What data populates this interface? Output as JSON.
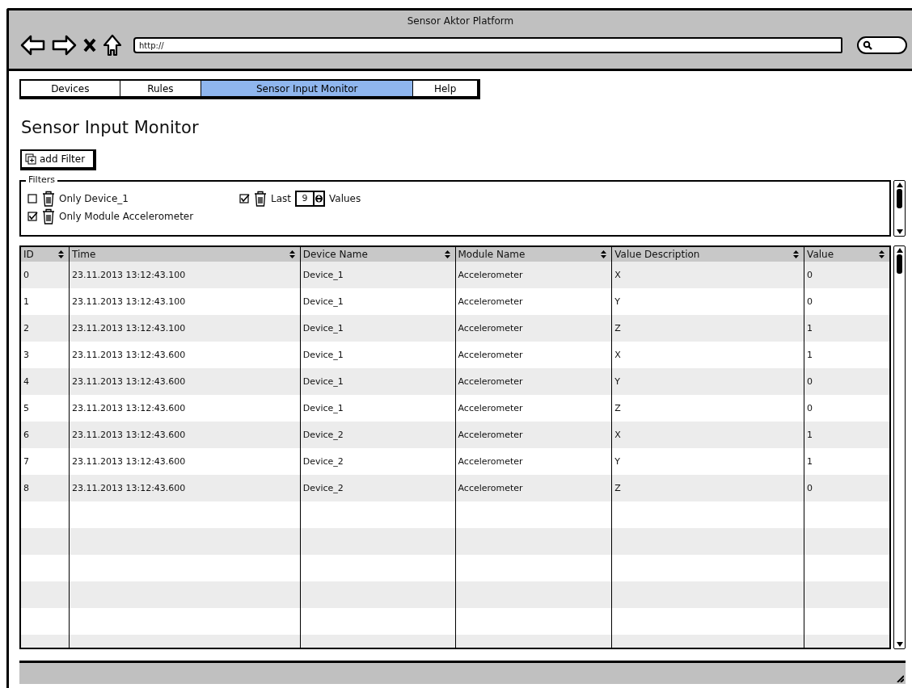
{
  "window": {
    "title": "Sensor Aktor Platform"
  },
  "browser": {
    "url": "http://"
  },
  "tabs": [
    {
      "label": "Devices",
      "selected": false
    },
    {
      "label": "Rules",
      "selected": false
    },
    {
      "label": "Sensor Input Monitor",
      "selected": true
    },
    {
      "label": "Help",
      "selected": false
    }
  ],
  "page_title": "Sensor Input Monitor",
  "add_filter_button": "add Filter",
  "filters": {
    "legend": "Filters",
    "items": [
      {
        "kind": "text",
        "label": "Only Device_1",
        "checked": false
      },
      {
        "kind": "text",
        "label": "Only Module Accelerometer",
        "checked": true
      },
      {
        "kind": "last",
        "prefix": "Last",
        "value": "9",
        "suffix": "Values",
        "checked": true
      }
    ]
  },
  "table": {
    "columns": [
      "ID",
      "Time",
      "Device Name",
      "Module Name",
      "Value Description",
      "Value"
    ],
    "rows": [
      [
        "0",
        "23.11.2013 13:12:43.100",
        "Device_1",
        "Accelerometer",
        "X",
        "0"
      ],
      [
        "1",
        "23.11.2013 13:12:43.100",
        "Device_1",
        "Accelerometer",
        "Y",
        "0"
      ],
      [
        "2",
        "23.11.2013 13:12:43.100",
        "Device_1",
        "Accelerometer",
        "Z",
        "1"
      ],
      [
        "3",
        "23.11.2013 13:12:43.600",
        "Device_1",
        "Accelerometer",
        "X",
        "1"
      ],
      [
        "4",
        "23.11.2013 13:12:43.600",
        "Device_1",
        "Accelerometer",
        "Y",
        "0"
      ],
      [
        "5",
        "23.11.2013 13:12:43.600",
        "Device_1",
        "Accelerometer",
        "Z",
        "0"
      ],
      [
        "6",
        "23.11.2013 13:12:43.600",
        "Device_2",
        "Accelerometer",
        "X",
        "1"
      ],
      [
        "7",
        "23.11.2013 13:12:43.600",
        "Device_2",
        "Accelerometer",
        "Y",
        "1"
      ],
      [
        "8",
        "23.11.2013 13:12:43.600",
        "Device_2",
        "Accelerometer",
        "Z",
        "0"
      ]
    ]
  }
}
